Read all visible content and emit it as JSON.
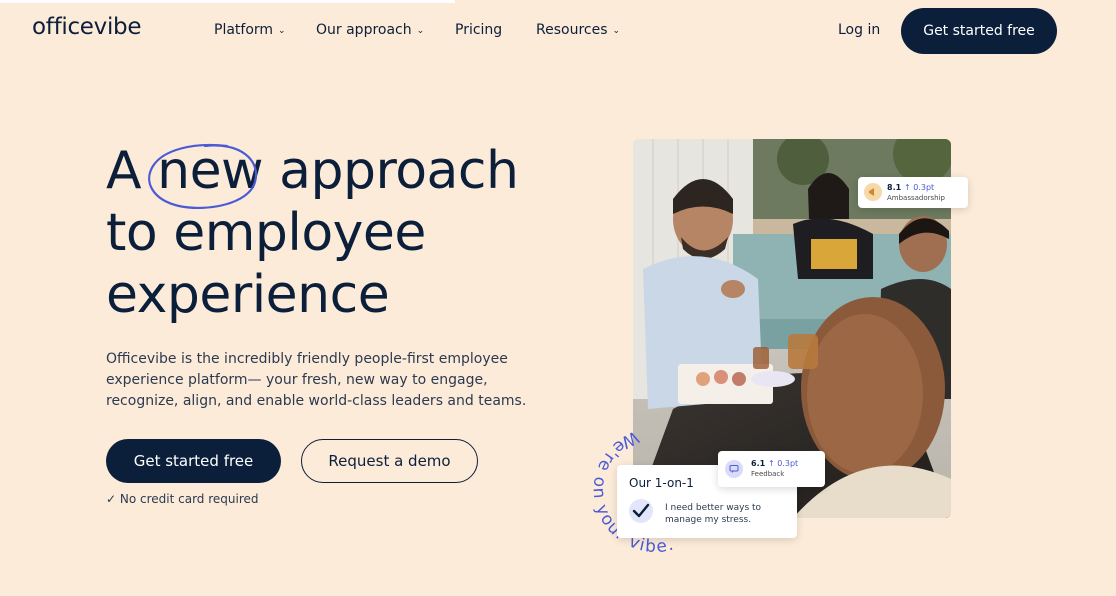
{
  "nav": {
    "logo": "officevibe",
    "items": [
      {
        "label": "Platform",
        "has_dropdown": true
      },
      {
        "label": "Our approach",
        "has_dropdown": true
      },
      {
        "label": "Pricing",
        "has_dropdown": false
      },
      {
        "label": "Resources",
        "has_dropdown": true
      }
    ],
    "login": "Log in",
    "cta": "Get started free"
  },
  "hero": {
    "title_word1": "A",
    "title_highlight": "new",
    "title_rest1": "approach",
    "title_line2": "to employee",
    "title_line3": "experience",
    "description": "Officevibe is the incredibly friendly people-first employee experience platform— your fresh, new way to engage, recognize, align, and enable world-class leaders and teams.",
    "primary_button": "Get started free",
    "secondary_button": "Request a demo",
    "note": "✓ No credit card required"
  },
  "cards": {
    "ambassadorship": {
      "value": "8.1",
      "delta": "↑ 0.3pt",
      "label": "Ambassadorship"
    },
    "feedback": {
      "value": "6.1",
      "delta": "↑ 0.3pt",
      "label": "Feedback"
    },
    "one_on_one": {
      "title": "Our 1-on-1",
      "text": "I need better ways to manage my stress."
    }
  },
  "arc_text": "We're on your vibe.",
  "colors": {
    "background": "#fdebd9",
    "navy": "#0b1f3a",
    "accent_blue": "#4b5bd6",
    "accent_orange": "#f2b66d"
  }
}
